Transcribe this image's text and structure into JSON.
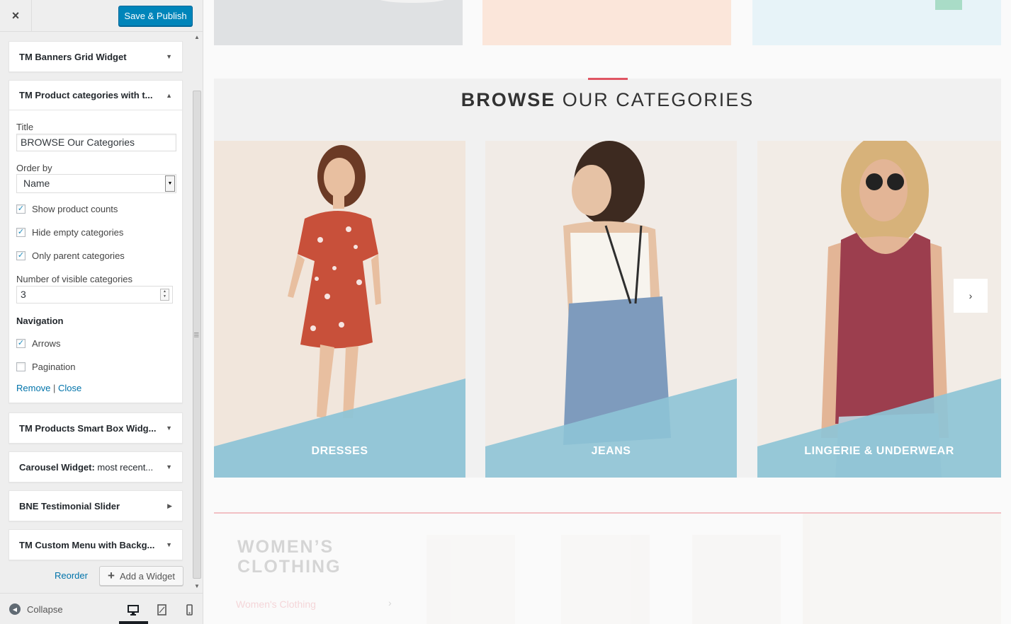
{
  "topbar": {
    "close_icon": "×",
    "save_label": "Save & Publish"
  },
  "widgets": [
    {
      "title": "TM Banners Grid Widget",
      "subtitle": ""
    },
    {
      "title": "TM Product categories with t...",
      "subtitle": ""
    },
    {
      "title": "TM Products Smart Box Widg...",
      "subtitle": ""
    },
    {
      "title": "Carousel Widget:",
      "subtitle": " most recent..."
    },
    {
      "title": "BNE Testimonial Slider",
      "subtitle": ""
    },
    {
      "title": "TM Custom Menu with Backg...",
      "subtitle": ""
    }
  ],
  "form": {
    "title_label": "Title",
    "title_value": "BROWSE Our Categories",
    "order_label": "Order by",
    "order_value": "Name",
    "show_counts": "Show product counts",
    "hide_empty": "Hide empty categories",
    "only_parent": "Only parent categories",
    "visible_label": "Number of visible categories",
    "visible_value": "3",
    "navigation_label": "Navigation",
    "arrows": "Arrows",
    "pagination": "Pagination",
    "remove": "Remove",
    "separator": " | ",
    "close": "Close"
  },
  "checkboxes": {
    "show_counts": true,
    "hide_empty": true,
    "only_parent": true,
    "arrows": true,
    "pagination": false
  },
  "actions": {
    "reorder": "Reorder",
    "add_widget": "Add a Widget"
  },
  "footer": {
    "collapse": "Collapse",
    "devices": [
      "desktop-icon",
      "tablet-icon",
      "mobile-icon"
    ]
  },
  "preview": {
    "section_title_strong": "BROWSE",
    "section_title_rest": " OUR CATEGORIES",
    "categories": [
      "DRESSES",
      "JEANS",
      "LINGERIE & UNDERWEAR"
    ],
    "next_arrow": "›",
    "womens_heading_1": "WOMEN’S",
    "womens_heading_2": "CLOTHING",
    "womens_link": "Women's Clothing",
    "womens_chevron": "›"
  },
  "colors": {
    "primary_button": "#0085ba",
    "link": "#0073aa",
    "accent": "#e05563",
    "category_overlay": "#8ec4d6"
  }
}
